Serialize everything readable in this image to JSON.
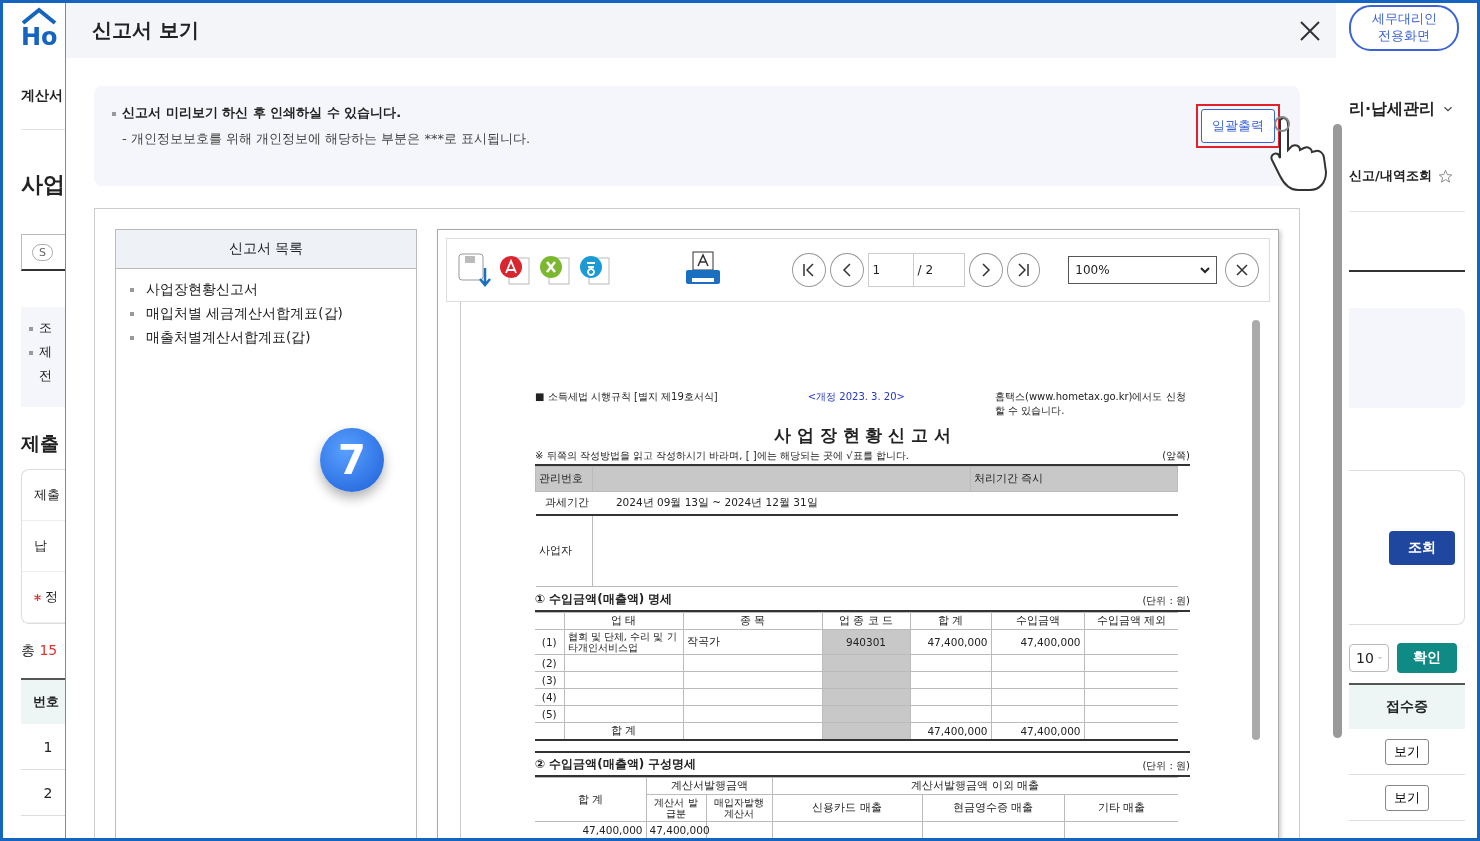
{
  "background": {
    "left": {
      "logo": "Ho",
      "menu": "계산서",
      "heading": "사업",
      "tab": "S",
      "notes": [
        {
          "text": "조",
          "bullet": true
        },
        {
          "text": "제",
          "bullet": true
        },
        {
          "text": "전",
          "bullet": false
        }
      ],
      "section": "제출",
      "form_rows": [
        {
          "label": "제출",
          "required": false
        },
        {
          "label": "납",
          "required": false
        },
        {
          "label": "정",
          "required": true
        }
      ],
      "total_label": "총",
      "total_count": "15",
      "column": "번호",
      "rows": [
        "1",
        "2"
      ]
    },
    "right": {
      "agent_button": "세무대리인 전용화면",
      "menu": "리·납세관리",
      "breadcrumb": "신고/내역조회",
      "search_button": "조회",
      "page_size": "10",
      "confirm_button": "확인",
      "column": "접수증",
      "row_buttons": [
        "보기",
        "보기"
      ]
    }
  },
  "modal": {
    "title": "신고서 보기",
    "notice": {
      "main": "신고서 미리보기 하신 후 인쇄하실 수 있습니다.",
      "sub": "- 개인정보보호를 위해 개인정보에 해당하는 부분은  ***로 표시됩니다."
    },
    "print_all_button": "일괄출력",
    "step_badge": "7",
    "list": {
      "title": "신고서 목록",
      "items": [
        "사업장현황신고서",
        "매입처별 세금계산서합계표(갑)",
        "매출처별계산서합계표(갑)"
      ]
    },
    "viewer": {
      "page": "1",
      "page_total": "/ 2",
      "zoom": "100%",
      "document": {
        "law": "■ 소득세법 시행규칙 [별지 제19호서식]",
        "revision": "<개정 2023. 3. 20>",
        "online_note": "홈택스(www.hometax.go.kr)에서도 신청 할 수 있습니다.",
        "title": "사 업 장 현 황 신 고 서",
        "instruction": "※ 뒤쪽의 작성방법을 읽고 작성하시기 바라며, [  ]에는 해당되는 곳에 √표를 합니다.",
        "side": "(앞쪽)",
        "mgmt_label": "관리번호",
        "period_label": "처리기간 즉시",
        "tax_period_label": "과세기간",
        "tax_period": "2024년  09월  13일   ~   2024년  12월  31일",
        "business_label": "사업자",
        "section1": {
          "title": "① 수입금액(매출액) 명세",
          "unit": "(단위 : 원)",
          "columns": [
            "업          태",
            "종          목",
            "업 종 코 드",
            "합  계",
            "수입금액",
            "수입금액 제외"
          ],
          "rows": [
            {
              "no": "(1)",
              "type": "협회 및 단체, 수리 및 기타개인서비스업",
              "item": "작곡가",
              "code": "940301",
              "total": "47,400,000",
              "income": "47,400,000"
            },
            {
              "no": "(2)"
            },
            {
              "no": "(3)"
            },
            {
              "no": "(4)"
            },
            {
              "no": "(5)"
            }
          ],
          "sum_label": "합          계",
          "sum_total": "47,400,000",
          "sum_income": "47,400,000"
        },
        "section2": {
          "title": "② 수입금액(매출액) 구성명세",
          "unit": "(단위 : 원)",
          "total_header": "합  계",
          "invoice_header": "계산서발행금액",
          "other_header": "계산서발행금액 이외 매출",
          "sub_headers": [
            "계산서 발급분",
            "매입자발행 계산서",
            "신용카드 매출",
            "현금영수증 매출",
            "기타 매출"
          ],
          "values": [
            "47,400,000",
            "47,400,000"
          ]
        }
      }
    }
  }
}
